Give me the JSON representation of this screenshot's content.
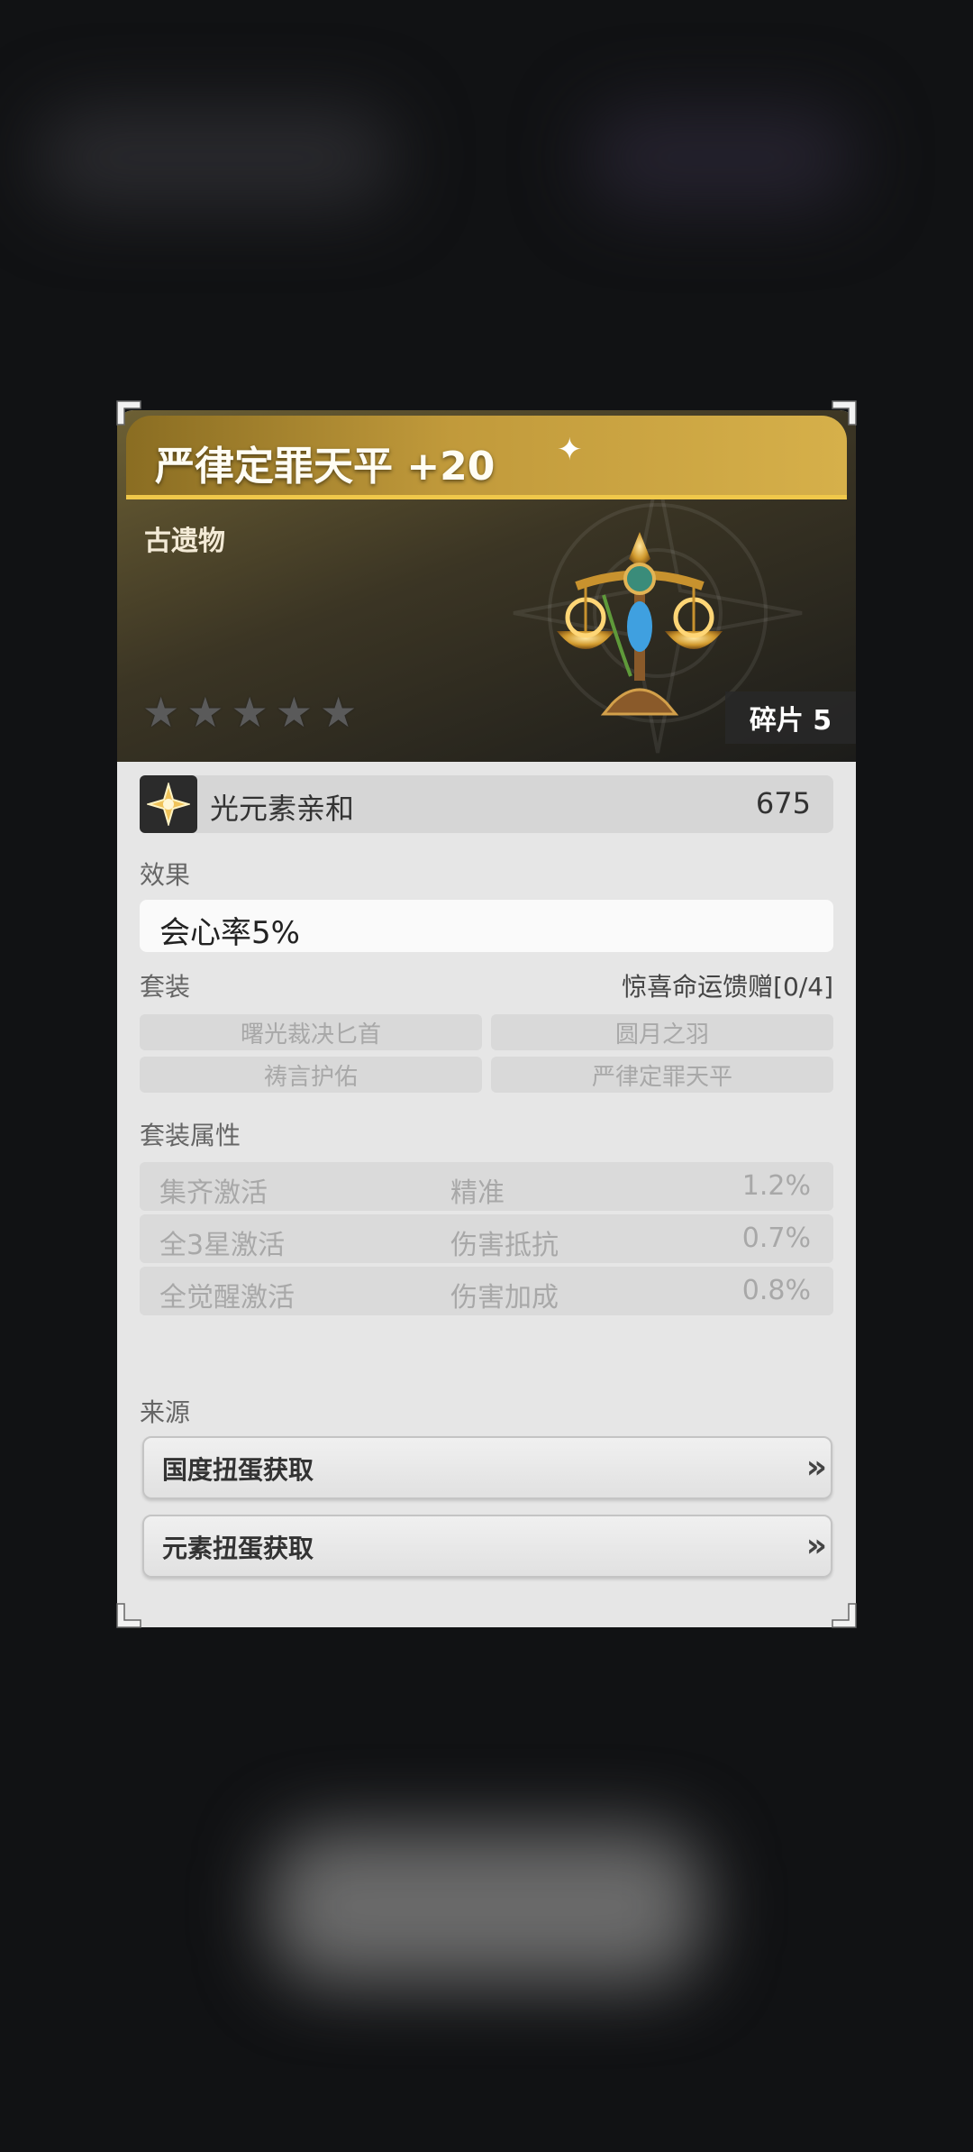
{
  "item": {
    "title": "严律定罪天平 +20",
    "type": "古遗物",
    "stars": [
      "★",
      "★",
      "★",
      "★",
      "★"
    ],
    "fragment": "碎片 5"
  },
  "stat": {
    "icon": "light-element-icon",
    "name": "光元素亲和",
    "value": "675"
  },
  "effect": {
    "label": "效果",
    "text": "会心率5%"
  },
  "set": {
    "label": "套装",
    "name": "惊喜命运馈赠[0/4]",
    "items": [
      "曙光裁决匕首",
      "圆月之羽",
      "祷言护佑",
      "严律定罪天平"
    ]
  },
  "set_attributes": {
    "label": "套装属性",
    "rows": [
      {
        "condition": "集齐激活",
        "attr": "精准",
        "value": "1.2%"
      },
      {
        "condition": "全3星激活",
        "attr": "伤害抵抗",
        "value": "0.7%"
      },
      {
        "condition": "全觉醒激活",
        "attr": "伤害加成",
        "value": "0.8%"
      }
    ]
  },
  "source": {
    "label": "来源",
    "buttons": [
      "国度扭蛋获取",
      "元素扭蛋获取"
    ],
    "chevron": "»"
  },
  "colors": {
    "accent": "#d6b04a",
    "card_bg": "#e6e6e6",
    "page_bg": "#111214"
  }
}
